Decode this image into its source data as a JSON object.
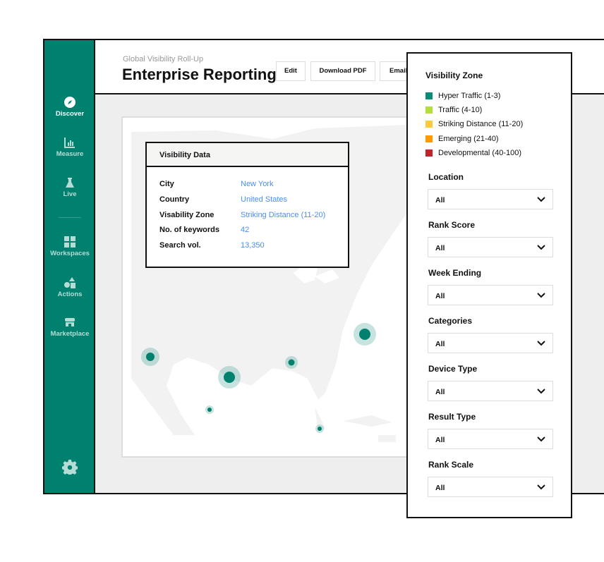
{
  "sidebar": {
    "items": [
      {
        "label": "Discover",
        "icon": "compass-icon"
      },
      {
        "label": "Measure",
        "icon": "bar-chart-icon"
      },
      {
        "label": "Live",
        "icon": "flask-icon"
      },
      {
        "label": "Workspaces",
        "icon": "grid-icon"
      },
      {
        "label": "Actions",
        "icon": "shapes-icon"
      },
      {
        "label": "Marketplace",
        "icon": "store-icon"
      }
    ],
    "settings_icon": "gear-icon"
  },
  "header": {
    "subtitle": "Global Visibility Roll-Up",
    "title": "Enterprise Reporting",
    "buttons": [
      "Edit",
      "Download PDF",
      "Email/"
    ]
  },
  "tooltip": {
    "title": "Visibility Data",
    "rows": [
      {
        "label": "City",
        "value": "New York"
      },
      {
        "label": "Country",
        "value": "United States"
      },
      {
        "label": "Visability Zone",
        "value": "Striking Distance (11-20)"
      },
      {
        "label": "No. of keywords",
        "value": "42"
      },
      {
        "label": "Search vol.",
        "value": "13,350"
      }
    ]
  },
  "panel": {
    "legend_title": "Visibility Zone",
    "legend": [
      {
        "label": "Hyper Traffic (1-3)",
        "color": "#0a8a78"
      },
      {
        "label": "Traffic (4-10)",
        "color": "#b3e038"
      },
      {
        "label": "Striking Distance (11-20)",
        "color": "#fcc93a"
      },
      {
        "label": "Emerging (21-40)",
        "color": "#ff9a00"
      },
      {
        "label": "Developmental (40-100)",
        "color": "#c0242a"
      }
    ],
    "filters": [
      {
        "label": "Location",
        "value": "All"
      },
      {
        "label": "Rank Score",
        "value": "All"
      },
      {
        "label": "Week Ending",
        "value": "All"
      },
      {
        "label": "Categories",
        "value": "All"
      },
      {
        "label": "Device Type",
        "value": "All"
      },
      {
        "label": "Result Type",
        "value": "All"
      },
      {
        "label": "Rank Scale",
        "value": "All"
      }
    ]
  },
  "colors": {
    "brand": "#00806f",
    "link": "#4a8ef0"
  }
}
